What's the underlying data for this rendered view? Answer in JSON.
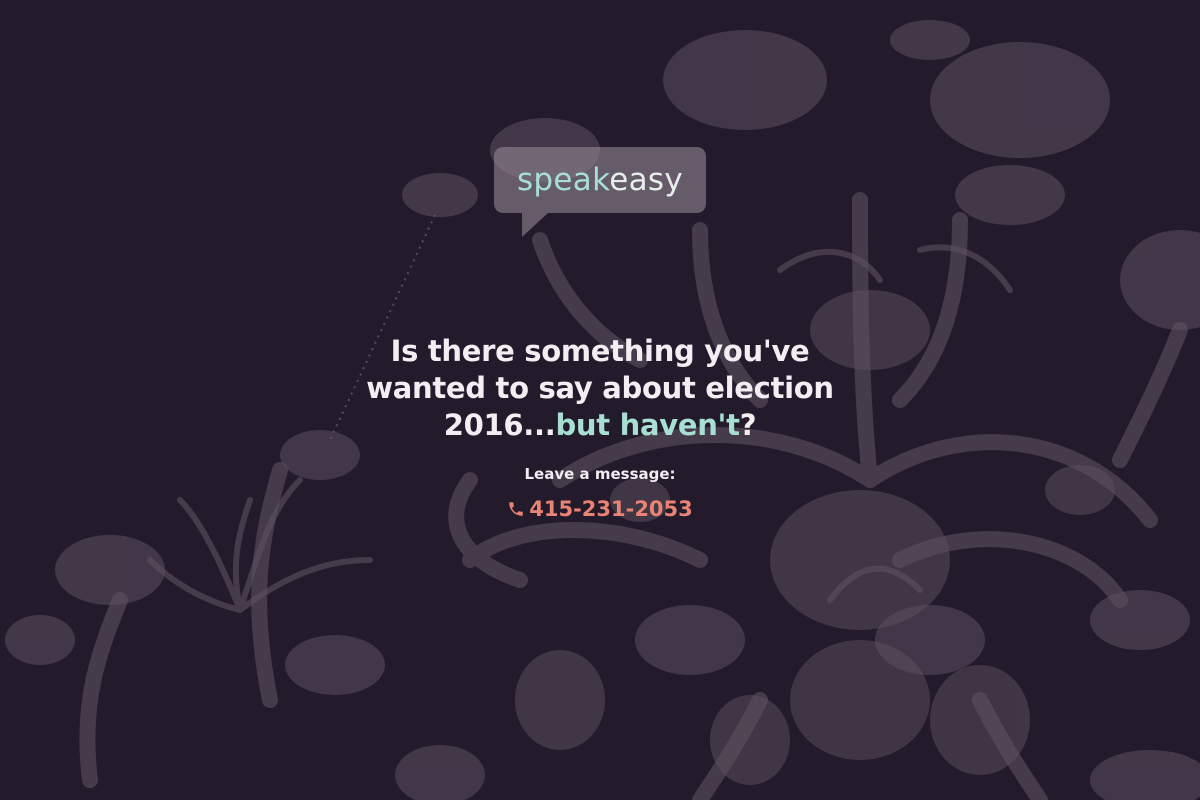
{
  "logo": {
    "part1": "speak",
    "part2": "easy"
  },
  "headline": {
    "line1": "Is there something you've",
    "line2": "wanted to say about election",
    "line3_start": "2016...",
    "line3_accent": "but haven't",
    "line3_end": "?"
  },
  "contact": {
    "label": "Leave a message:",
    "phone": "415-231-2053",
    "icon": "phone-icon"
  },
  "colors": {
    "background": "#231a2b",
    "accent_mint": "#a7e0d2",
    "accent_coral": "#e98373",
    "text_light": "#f3eef2",
    "chandelier": "#6a5e6a"
  },
  "background_image": "chandelier silhouette"
}
